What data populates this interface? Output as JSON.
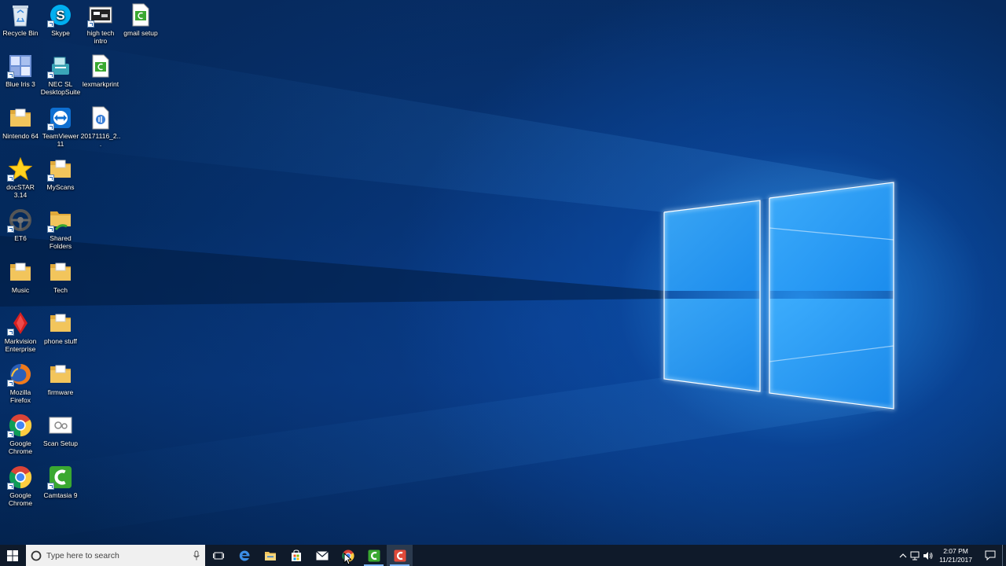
{
  "desktop": {
    "icons": [
      {
        "label": "Recycle Bin",
        "icon": "recycle-bin-icon"
      },
      {
        "label": "Skype",
        "icon": "skype-icon"
      },
      {
        "label": "high tech intro",
        "icon": "video-file-icon"
      },
      {
        "label": "gmail setup",
        "icon": "camtasia-project-icon"
      },
      {
        "label": "Blue Iris 3",
        "icon": "blue-iris-icon"
      },
      {
        "label": "NEC SL DesktopSuite",
        "icon": "nec-icon"
      },
      {
        "label": "lexmarkprint",
        "icon": "camtasia-project-icon"
      },
      {
        "label": "Nintendo 64",
        "icon": "folder-icon"
      },
      {
        "label": "TeamViewer 11",
        "icon": "teamviewer-icon"
      },
      {
        "label": "20171116_2...",
        "icon": "audio-file-icon"
      },
      {
        "label": "docSTAR 3.14",
        "icon": "star-icon"
      },
      {
        "label": "MyScans",
        "icon": "folder-icon"
      },
      {
        "label": "ET6",
        "icon": "steering-wheel-icon"
      },
      {
        "label": "Shared Folders",
        "icon": "shared-folder-icon"
      },
      {
        "label": "Music",
        "icon": "folder-icon"
      },
      {
        "label": "Tech",
        "icon": "folder-icon"
      },
      {
        "label": "Markvision Enterprise",
        "icon": "markvision-icon"
      },
      {
        "label": "phone stuff",
        "icon": "folder-icon"
      },
      {
        "label": "Mozilla Firefox",
        "icon": "firefox-icon"
      },
      {
        "label": "firmware",
        "icon": "folder-icon"
      },
      {
        "label": "Google Chrome",
        "icon": "chrome-icon"
      },
      {
        "label": "Scan Setup",
        "icon": "scan-setup-icon"
      },
      {
        "label": "Google Chrome",
        "icon": "chrome-icon"
      },
      {
        "label": "Camtasia 9",
        "icon": "camtasia-icon"
      }
    ]
  },
  "taskbar": {
    "search_placeholder": "Type here to search",
    "pinned": [
      {
        "name": "task-view",
        "icon": "task-view-icon"
      },
      {
        "name": "edge",
        "icon": "edge-icon"
      },
      {
        "name": "file-explorer",
        "icon": "file-explorer-icon"
      },
      {
        "name": "store",
        "icon": "store-icon"
      },
      {
        "name": "mail",
        "icon": "mail-icon"
      },
      {
        "name": "chrome",
        "icon": "chrome-icon"
      },
      {
        "name": "camtasia",
        "icon": "camtasia-icon"
      },
      {
        "name": "camtasia-recorder",
        "icon": "camtasia-recorder-icon"
      }
    ],
    "clock": {
      "time": "2:07 PM",
      "date": "11/21/2017"
    }
  },
  "colors": {
    "taskbar": "#0f1a2a",
    "accent": "#7fb6ff",
    "folder": "#f2c55c"
  }
}
